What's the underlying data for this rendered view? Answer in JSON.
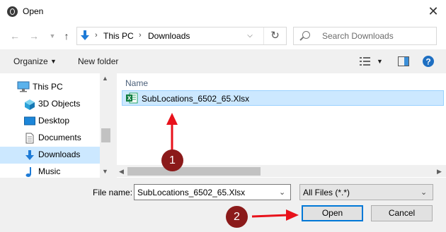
{
  "window": {
    "title": "Open",
    "close_label": "✕"
  },
  "address": {
    "segments": [
      "This PC",
      "Downloads"
    ]
  },
  "search": {
    "placeholder": "Search Downloads"
  },
  "toolbar": {
    "organize_label": "Organize",
    "new_folder_label": "New folder"
  },
  "sidebar": {
    "items": [
      {
        "label": "This PC",
        "icon": "computer-icon"
      },
      {
        "label": "3D Objects",
        "icon": "3d-objects-icon"
      },
      {
        "label": "Desktop",
        "icon": "desktop-icon"
      },
      {
        "label": "Documents",
        "icon": "documents-icon"
      },
      {
        "label": "Downloads",
        "icon": "downloads-icon",
        "selected": true
      },
      {
        "label": "Music",
        "icon": "music-icon"
      }
    ]
  },
  "file_list": {
    "column_header": "Name",
    "files": [
      {
        "name": "SubLocations_6502_65.Xlsx",
        "icon": "excel-file-icon",
        "selected": true
      }
    ]
  },
  "bottom": {
    "file_name_label": "File name:",
    "file_name_value": "SubLocations_6502_65.Xlsx",
    "file_type_value": "All Files (*.*)",
    "open_label": "Open",
    "cancel_label": "Cancel"
  },
  "annotations": {
    "step1": "1",
    "step2": "2"
  },
  "colors": {
    "accent": "#0078d7",
    "selection": "#cce8ff",
    "badge": "#8b1a1a",
    "arrow": "#e8121b"
  }
}
